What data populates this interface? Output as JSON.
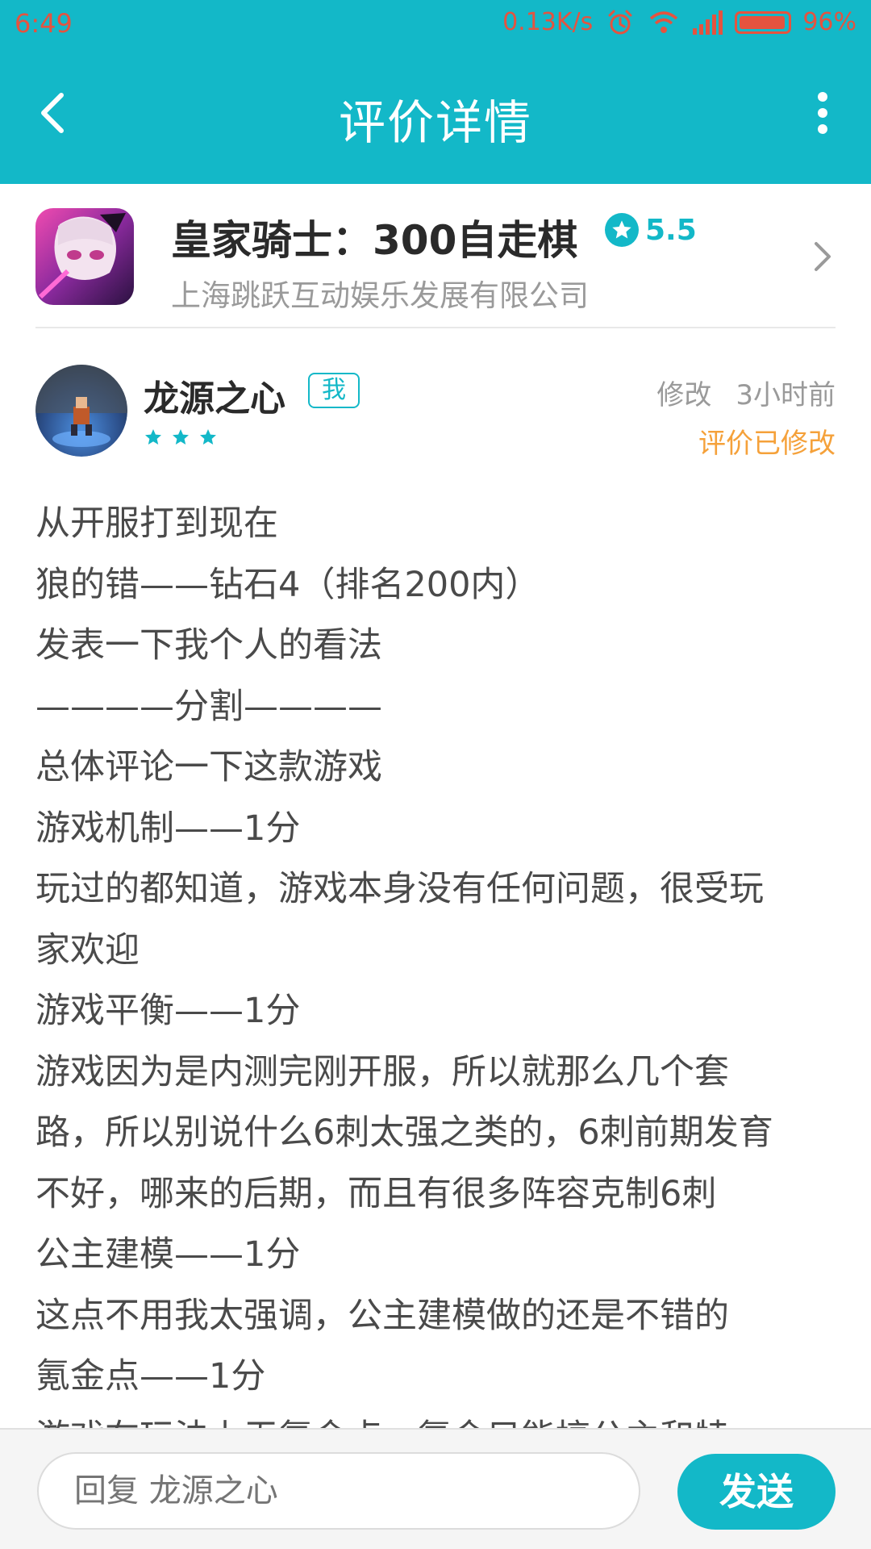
{
  "status_bar": {
    "time": "6:49",
    "speed": "0.13K/s",
    "battery": "96%",
    "icons": [
      "alarm-icon",
      "wifi-icon",
      "signal-icon",
      "battery-icon"
    ]
  },
  "header": {
    "title": "评价详情",
    "back_icon": "chevron-left-icon",
    "more_icon": "more-vertical-icon"
  },
  "game": {
    "name": "皇家骑士：300自走棋",
    "rating": "5.5",
    "company": "上海跳跃互动娱乐发展有限公司"
  },
  "review": {
    "reviewer": "龙源之心",
    "me_badge": "我",
    "stars": 3,
    "edit_label": "修改",
    "time": "3小时前",
    "modified": "评价已修改",
    "lines": [
      "从开服打到现在",
      "狼的错——钻石4（排名200内）",
      "发表一下我个人的看法",
      "————分割————",
      "总体评论一下这款游戏",
      "游戏机制——1分",
      "玩过的都知道，游戏本身没有任何问题，很受玩",
      "家欢迎",
      "游戏平衡——1分",
      "游戏因为是内测完刚开服，所以就那么几个套",
      "路，所以别说什么6刺太强之类的，6刺前期发育",
      "不好，哪来的后期，而且有很多阵容克制6刺",
      "公主建模——1分",
      "这点不用我太强调，公主建模做的还是不错的",
      "氪金点——1分",
      "游戏在玩法上无氪金点，氪金只能搞公主和特"
    ]
  },
  "reply": {
    "placeholder": "回复 龙源之心",
    "send": "发送"
  },
  "colors": {
    "accent": "#13b8c8",
    "modified": "#f5a13a",
    "status": "#e5533f"
  }
}
